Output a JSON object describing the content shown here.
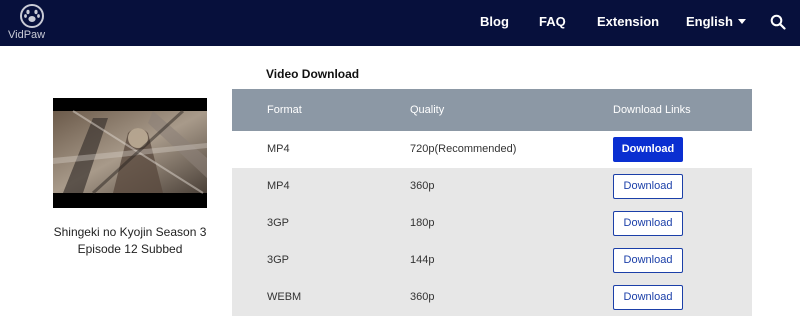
{
  "header": {
    "logo_text": "VidPaw",
    "nav": [
      "Blog",
      "FAQ",
      "Extension",
      "English"
    ]
  },
  "video": {
    "caption_line1": "Shingeki no Kyojin Season 3",
    "caption_line2": "Episode 12 Subbed"
  },
  "section_title": "Video Download",
  "table": {
    "headers": [
      "Format",
      "Quality",
      "Download Links"
    ],
    "rows": [
      {
        "format": "MP4",
        "quality": "720p(Recommended)",
        "button": "Download"
      },
      {
        "format": "MP4",
        "quality": "360p",
        "button": "Download"
      },
      {
        "format": "3GP",
        "quality": "180p",
        "button": "Download"
      },
      {
        "format": "3GP",
        "quality": "144p",
        "button": "Download"
      },
      {
        "format": "WEBM",
        "quality": "360p",
        "button": "Download"
      }
    ]
  },
  "colors": {
    "header_bg": "#07103c",
    "table_header_bg": "#8c98a5",
    "primary_button": "#0a2fd1"
  },
  "icons": [
    "paw-logo-icon",
    "search-icon",
    "caret-down-icon"
  ]
}
